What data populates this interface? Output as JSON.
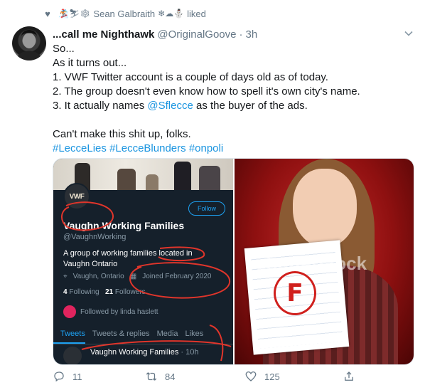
{
  "social_context": {
    "emoji_before": "🏂⛷❄",
    "user": "Sean Galbraith",
    "emoji_after": "❄☁⛄",
    "action": "liked"
  },
  "tweet": {
    "display_name": "...call me Nighthawk",
    "handle": "@OriginalGoove",
    "separator": "·",
    "time": "3h",
    "lines": {
      "l1": "So...",
      "l2": "As it turns out...",
      "l3": "1. VWF Twitter account is a couple of days old as of today.",
      "l4": "2. The group doesn't even know how to spell it's own city's name.",
      "l5_pre": "3. It actually names ",
      "l5_mention": "@Sflecce",
      "l5_post": " as the buyer of the ads.",
      "l6": "Can't make this shit up, folks."
    },
    "hashtags": [
      "#LecceLies",
      "#LecceBlunders",
      "#onpoli"
    ]
  },
  "embedded_profile": {
    "avatar_text": "VWF",
    "follow_label": "Follow",
    "name": "Vaughn Working Families",
    "handle": "@VaughnWorking",
    "bio": "A group of working families located in Vaughn Ontario",
    "location": "Vaughn, Ontario",
    "joined": "Joined February 2020",
    "following_count": "4",
    "following_label": "Following",
    "followers_count": "21",
    "followers_label": "Followers",
    "followed_by": "Followed by linda haslett",
    "tabs": [
      "Tweets",
      "Tweets & replies",
      "Media",
      "Likes"
    ],
    "tweet_name": "Vaughn Working Families",
    "tweet_time": "· 10h"
  },
  "stock_image": {
    "watermark": "shutterstock",
    "grade": "F"
  },
  "actions": {
    "reply_count": "11",
    "retweet_count": "84",
    "like_count": "125"
  },
  "colors": {
    "link": "#1b95e0",
    "muted": "#657786",
    "annotation_red": "#e0352b"
  }
}
